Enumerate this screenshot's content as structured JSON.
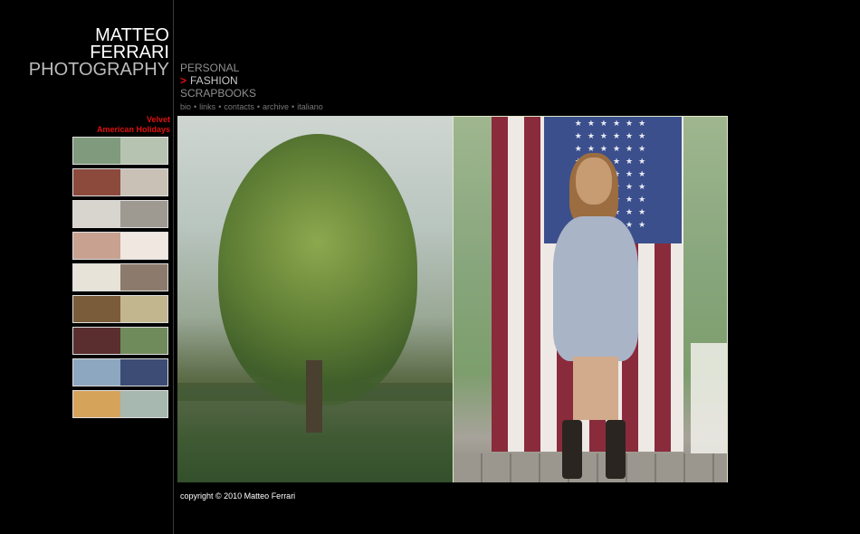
{
  "logo": {
    "line1": "MATTEO",
    "line2": "FERRARI",
    "line3": "PHOTOGRAPHY"
  },
  "gallery": {
    "line1": "Velvet",
    "line2": "American Holidays"
  },
  "nav": {
    "items": [
      {
        "label": "PERSONAL",
        "active": false
      },
      {
        "label": "FASHION",
        "active": true,
        "marker": ">"
      },
      {
        "label": "SCRAPBOOKS",
        "active": false
      }
    ]
  },
  "subnav": {
    "links": [
      "bio",
      "links",
      "contacts",
      "archive",
      "italiano"
    ],
    "separator": "•"
  },
  "thumbnails": [
    {
      "left": "#7f9a7c",
      "right": "#b7c3b1"
    },
    {
      "left": "#8b4a3c",
      "right": "#c9c1b5"
    },
    {
      "left": "#d8d4ce",
      "right": "#9e9a92"
    },
    {
      "left": "#c8a190",
      "right": "#f0e8e0"
    },
    {
      "left": "#e7e3d9",
      "right": "#8c7b6d"
    },
    {
      "left": "#7a5b3a",
      "right": "#c2b68f"
    },
    {
      "left": "#5a2e2e",
      "right": "#6f8b5b"
    },
    {
      "left": "#8ea7c1",
      "right": "#3c4c74"
    },
    {
      "left": "#d6a35b",
      "right": "#a7b8b0"
    }
  ],
  "footer": {
    "copyright": "copyright © 2010 Matteo Ferrari"
  },
  "colors": {
    "accent": "#e01010",
    "background": "#000000"
  }
}
